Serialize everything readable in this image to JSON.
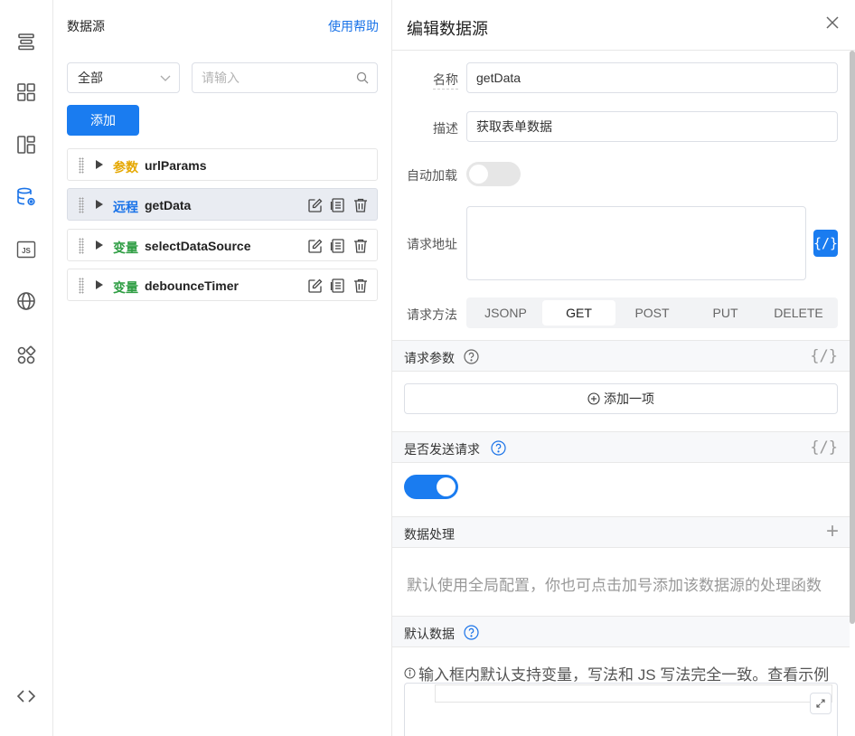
{
  "rail": {
    "items": [
      {
        "icon": "outline-icon"
      },
      {
        "icon": "components-icon"
      },
      {
        "icon": "layout-icon"
      },
      {
        "icon": "datasource-icon",
        "active": true
      },
      {
        "icon": "js-icon",
        "text": "JS"
      },
      {
        "icon": "globe-icon"
      },
      {
        "icon": "apps-icon"
      },
      {
        "icon": "code-icon"
      }
    ]
  },
  "list_panel": {
    "title": "数据源",
    "help_link": "使用帮助",
    "filter_value": "全部",
    "search_placeholder": "请输入",
    "add_button": "添加",
    "items": [
      {
        "type_label": "参数",
        "type_color": "#e5a700",
        "name": "urlParams",
        "active": false,
        "has_actions": false
      },
      {
        "type_label": "远程",
        "type_color": "#1a73e8",
        "name": "getData",
        "active": true,
        "has_actions": true
      },
      {
        "type_label": "变量",
        "type_color": "#2f9e44",
        "name": "selectDataSource",
        "active": false,
        "has_actions": true
      },
      {
        "type_label": "变量",
        "type_color": "#2f9e44",
        "name": "debounceTimer",
        "active": false,
        "has_actions": true
      }
    ]
  },
  "edit_panel": {
    "title": "编辑数据源",
    "fields": {
      "name_label": "名称",
      "name_value": "getData",
      "desc_label": "描述",
      "desc_value": "获取表单数据",
      "autoload_label": "自动加载",
      "autoload_on": false,
      "url_label": "请求地址",
      "url_value": "",
      "url_code_button": "{/}",
      "method_label": "请求方法",
      "methods": [
        "JSONP",
        "GET",
        "POST",
        "PUT",
        "DELETE"
      ],
      "method_selected": "GET"
    },
    "sections": {
      "params_title": "请求参数",
      "params_add": "添加一项",
      "send_title": "是否发送请求",
      "send_on": true,
      "process_title": "数据处理",
      "process_hint": "默认使用全局配置，你也可点击加号添加该数据源的处理函数",
      "default_title": "默认数据",
      "default_info": "输入框内默认支持变量，写法和 JS 写法完全一致。查看示例",
      "code_brace": "{/}"
    }
  },
  "colors": {
    "primary": "#1a7cf0",
    "switch_off": "#e6e6e6",
    "active_row": "#e9ecf2"
  }
}
